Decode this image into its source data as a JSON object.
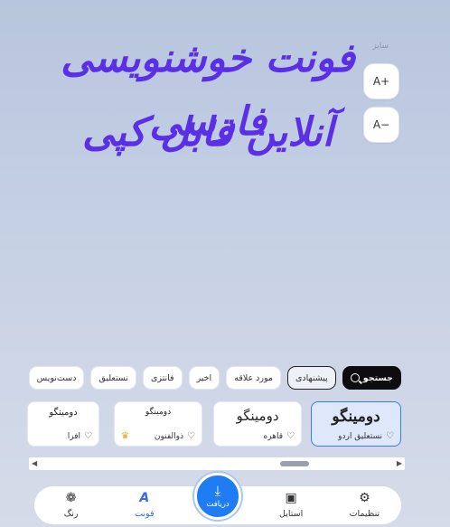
{
  "preview": {
    "line1": "فونت خوشنویسی فارسی",
    "line2": "آنلاین قابل کپی"
  },
  "size_controls": {
    "label": "سایز",
    "increase": "A+",
    "decrease": "A−"
  },
  "filters": {
    "search": "جستجو",
    "items": [
      "پیشنهادی",
      "مورد علاقه",
      "اخیر",
      "فانتزی",
      "نستعلیق",
      "دست‌نویس"
    ]
  },
  "fonts": [
    {
      "sample": "دومینگو",
      "name": "نستعلیق اردو",
      "selected": true
    },
    {
      "sample": "دومینگو",
      "name": "قاهره"
    },
    {
      "sample": "دومینگو",
      "name": "ذوالفنون",
      "premium": true
    },
    {
      "sample": "دومینگو",
      "name": "افرا"
    }
  ],
  "nav": {
    "settings": "تنظیمات",
    "style": "استایل",
    "download": "دریافت",
    "font": "فونت",
    "color": "رنگ"
  },
  "icons": {
    "search": "search-icon",
    "heart": "heart-icon",
    "crown": "crown-icon",
    "gear": "gear-icon",
    "style": "style-icon",
    "download": "download-icon",
    "font": "font-icon",
    "color": "palette-icon"
  },
  "colors": {
    "accent": "#1f7cf3",
    "preview_text": "#5b2fe6",
    "selected_card_bg": "#dfe8fb"
  }
}
